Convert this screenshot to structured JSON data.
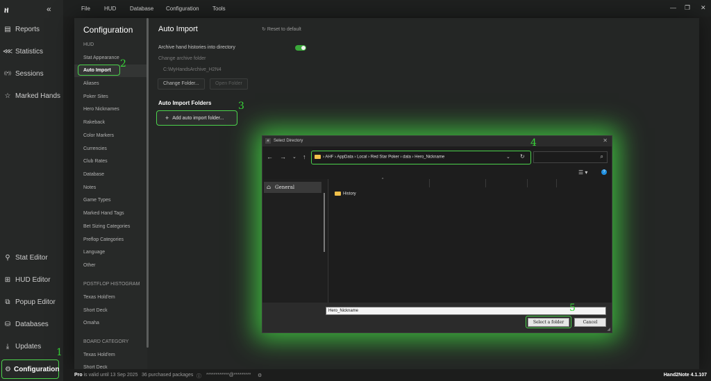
{
  "app": {
    "logo": "ዘ",
    "version": "Hand2Note 4.1.107"
  },
  "leftnav": {
    "collapse": "«",
    "items": [
      {
        "label": "Reports",
        "icon": "report-icon",
        "glyph": "▤"
      },
      {
        "label": "Statistics",
        "icon": "share-icon",
        "glyph": "⋘"
      },
      {
        "label": "Sessions",
        "icon": "broadcast-icon",
        "glyph": "((•))"
      },
      {
        "label": "Marked Hands",
        "icon": "star-icon",
        "glyph": "☆"
      },
      {
        "label": "Stat Editor",
        "icon": "stat-edit-icon",
        "glyph": "⚲"
      },
      {
        "label": "HUD Editor",
        "icon": "hud-edit-icon",
        "glyph": "⊞"
      },
      {
        "label": "Popup Editor",
        "icon": "popup-edit-icon",
        "glyph": "⧉"
      },
      {
        "label": "Databases",
        "icon": "database-icon",
        "glyph": "⛁"
      },
      {
        "label": "Updates",
        "icon": "download-icon",
        "glyph": "⤓"
      },
      {
        "label": "Configuration",
        "icon": "gear-icon",
        "glyph": "⚙"
      }
    ]
  },
  "menu": {
    "items": [
      "File",
      "HUD",
      "Database",
      "Configuration",
      "Tools"
    ]
  },
  "window": {
    "minimize": "—",
    "restore": "❐",
    "close": "✕"
  },
  "config": {
    "title": "Configuration",
    "items": [
      {
        "label": "HUD",
        "header": true
      },
      {
        "label": "Stat Appearance"
      },
      {
        "label": "Auto Import",
        "active": true
      },
      {
        "label": "Aliases"
      },
      {
        "label": "Poker Sites"
      },
      {
        "label": "Hero Nicknames"
      },
      {
        "label": "Rakeback"
      },
      {
        "label": "Color Markers"
      },
      {
        "label": "Currencies"
      },
      {
        "label": "Club Rates"
      },
      {
        "label": "Database"
      },
      {
        "label": "Notes"
      },
      {
        "label": "Game Types"
      },
      {
        "label": "Marked Hand Tags"
      },
      {
        "label": "Bet Sizing Categories"
      },
      {
        "label": "Preflop Categories"
      },
      {
        "label": "Language"
      },
      {
        "label": "Other"
      },
      {
        "label": "POSTFLOP HISTOGRAM",
        "header": true
      },
      {
        "label": "Texas Hold'em"
      },
      {
        "label": "Short Deck"
      },
      {
        "label": "Omaha"
      },
      {
        "label": "BOARD CATEGORY",
        "header": true
      },
      {
        "label": "Texas Hold'em"
      },
      {
        "label": "Short Deck"
      }
    ]
  },
  "auto_import": {
    "title": "Auto Import",
    "reset": "Reset to default",
    "archive_label": "Archive hand histories into directory",
    "archive_enabled": true,
    "change_folder_label": "Change archive folder",
    "archive_path": "C:\\MyHandsArchive_H2N4",
    "change_folder_button": "Change Folder...",
    "open_folder_button": "Open Folder",
    "folders_title": "Auto Import Folders",
    "add_button": "Add auto import folder..."
  },
  "dialog": {
    "title": "Select Directory",
    "breadcrumb": [
      "AHF",
      "AppData",
      "Local",
      "Red Star Poker",
      "data",
      "Hero_Nickname"
    ],
    "nav_general": "General",
    "files": [
      "History"
    ],
    "filename_value": "Hero_Nickname",
    "select_button": "Select a folder",
    "cancel_button": "Cancel"
  },
  "markers": [
    "1",
    "2",
    "3",
    "4",
    "5"
  ],
  "status": {
    "plan": "Pro",
    "valid": "is valid until 13 Sep 2025",
    "packages": "36 purchased packages",
    "account": "************@*********"
  },
  "colors": {
    "accent": "#4cd44c",
    "marker": "#39d839",
    "folder": "#f1c04a"
  }
}
